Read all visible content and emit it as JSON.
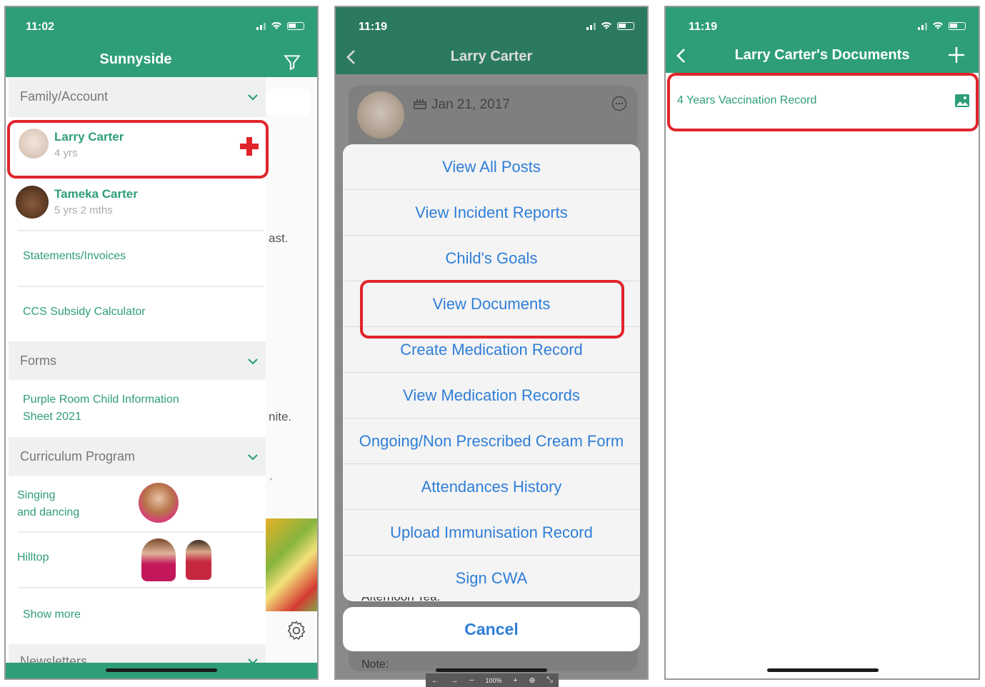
{
  "panel1": {
    "time": "11:02",
    "title": "Sunnyside",
    "sections": {
      "family": "Family/Account",
      "forms": "Forms",
      "curriculum": "Curriculum Program",
      "newsletters": "Newsletters"
    },
    "children": [
      {
        "name": "Larry Carter",
        "age": "4 yrs"
      },
      {
        "name": "Tameka Carter",
        "age": "5 yrs 2 mths"
      }
    ],
    "links": {
      "statements": "Statements/Invoices",
      "ccs": "CCS Subsidy Calculator",
      "form1_line1": "Purple Room Child Information",
      "form1_line2": "Sheet 2021",
      "show_more": "Show more"
    },
    "curriculum": [
      {
        "line1": "Singing",
        "line2": "and dancing"
      },
      {
        "line1": "Hilltop",
        "line2": ""
      }
    ],
    "peek_text": {
      "a": "ast.",
      "b": "nite.",
      "c": "'"
    }
  },
  "panel2": {
    "time": "11:19",
    "title": "Larry Carter",
    "date": "Jan 21, 2017",
    "menu": [
      "View All Posts",
      "View Incident Reports",
      "Child's Goals",
      "View Documents",
      "Create Medication Record",
      "View Medication Records",
      "Ongoing/Non Prescribed Cream Form",
      "Attendances History",
      "Upload Immunisation Record",
      "Sign CWA"
    ],
    "behind_text": "Afternoon Tea:",
    "cancel": "Cancel",
    "note": "Note:",
    "zoom": "100%"
  },
  "panel3": {
    "time": "11:19",
    "title": "Larry Carter's Documents",
    "documents": [
      {
        "name": "4 Years Vaccination Record"
      }
    ]
  },
  "colors": {
    "brand": "#2e9e78",
    "highlight": "#e0242a",
    "link": "#2f7ed8"
  }
}
